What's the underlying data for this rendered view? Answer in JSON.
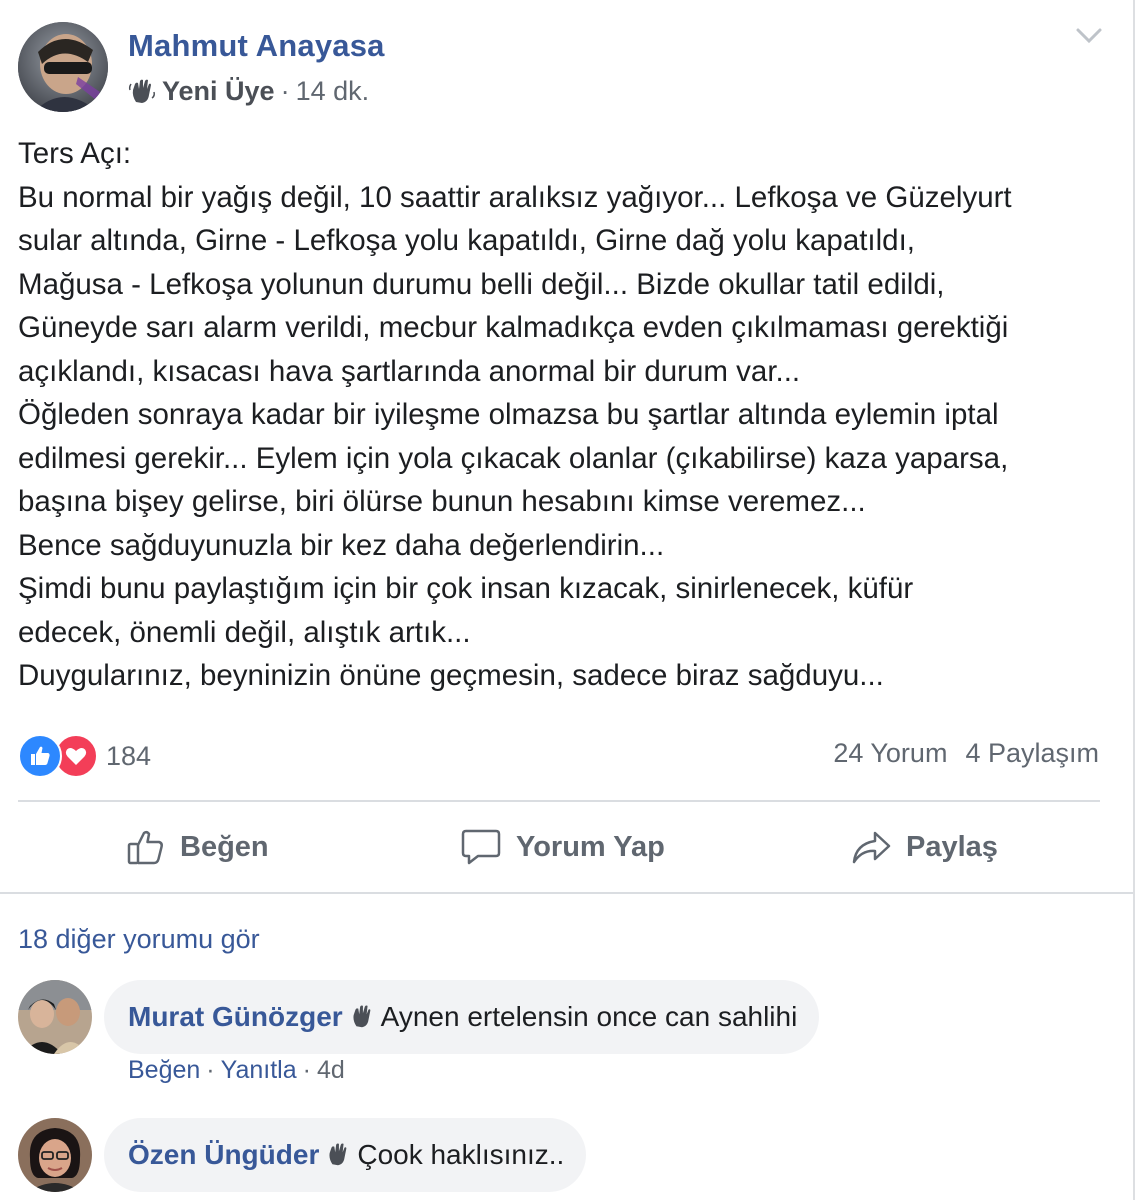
{
  "post": {
    "author": "Mahmut Anayasa",
    "badge": "Yeni Üye",
    "separator": "·",
    "time": "14 dk.",
    "text_lines": [
      "Ters Açı:",
      "Bu normal bir yağış değil, 10 saattir aralıksız yağıyor... Lefkoşa ve Güzelyurt",
      "sular altında, Girne - Lefkoşa yolu kapatıldı, Girne dağ yolu kapatıldı,",
      "Mağusa - Lefkoşa yolunun durumu belli değil... Bizde okullar tatil edildi,",
      "Güneyde sarı alarm verildi, mecbur kalmadıkça evden çıkılmaması gerektiği",
      "açıklandı, kısacası hava şartlarında anormal bir durum var...",
      "Öğleden sonraya kadar bir iyileşme olmazsa bu şartlar altında eylemin iptal",
      "edilmesi gerekir... Eylem için yola çıkacak olanlar (çıkabilirse) kaza yaparsa,",
      "başına bişey gelirse, biri ölürse bunun hesabını kimse veremez...",
      "Bence sağduyunuzla bir kez daha değerlendirin...",
      "Şimdi bunu paylaştığım için bir çok insan kızacak, sinirlenecek, küfür",
      "edecek, önemli değil, alıştık artık...",
      "Duygularınız, beyninizin önüne geçmesin, sadece biraz sağduyu..."
    ],
    "reaction_count": "184",
    "comment_count": "24 Yorum",
    "share_count": "4 Paylaşım"
  },
  "actions": {
    "like": "Beğen",
    "comment": "Yorum Yap",
    "share": "Paylaş"
  },
  "comments_section": {
    "more_comments": "18 diğer yorumu gör",
    "comments": [
      {
        "author": "Murat Günözger",
        "text": "Aynen ertelensin once can sahlihi",
        "like": "Beğen",
        "reply": "Yanıtla",
        "time": "4d",
        "separator": "·"
      },
      {
        "author": "Özen Üngüder",
        "text": "Çook haklısınız.."
      }
    ]
  },
  "icons": {
    "badge": "waving-hand-icon",
    "menu": "chevron-down-icon",
    "like_reaction": "thumbs-up-icon",
    "love_reaction": "heart-icon",
    "like_action": "thumbs-up-outline-icon",
    "comment_action": "speech-bubble-icon",
    "share_action": "share-arrow-icon"
  },
  "colors": {
    "link_blue": "#385898",
    "secondary_text": "#606770",
    "like_blue": "#2d88ff",
    "love_red": "#f33e58",
    "bubble_bg": "#f2f3f5"
  }
}
